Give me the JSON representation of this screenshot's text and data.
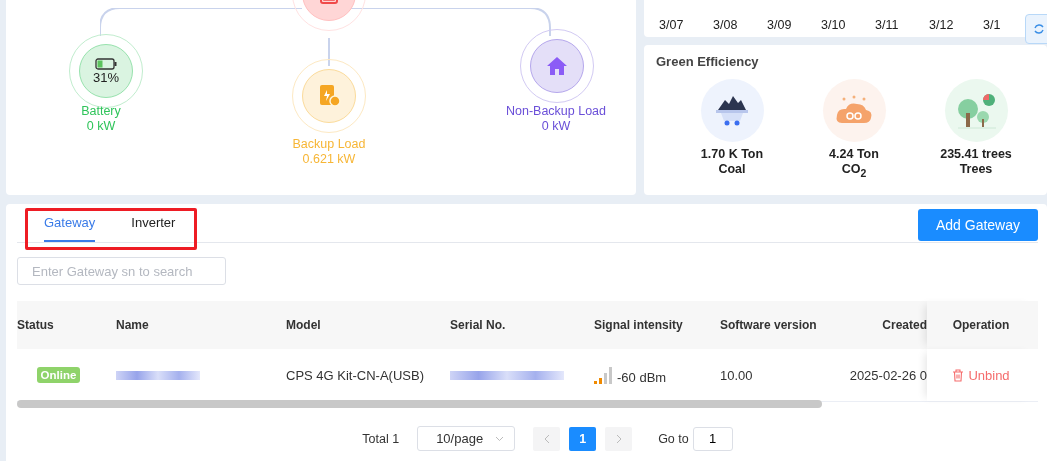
{
  "flow": {
    "nodes": [
      {
        "kind": "battery",
        "label": "Battery",
        "value": "0 kW",
        "reading": "31%"
      },
      {
        "kind": "backup",
        "label": "Backup Load",
        "value": "0.621 kW"
      },
      {
        "kind": "home",
        "label": "Non-Backup Load",
        "value": "0 kW"
      }
    ]
  },
  "forecast": {
    "dates": [
      "3/07",
      "3/08",
      "3/09",
      "3/10",
      "3/11",
      "3/12",
      "3/1"
    ]
  },
  "green_efficiency": {
    "title": "Green Efficiency",
    "items": [
      {
        "kind": "coal",
        "value": "1.70 K Ton",
        "label": "Coal"
      },
      {
        "kind": "co2",
        "value": "4.24 Ton",
        "label": "CO$_{2}$"
      },
      {
        "kind": "trees",
        "value": "235.41 trees",
        "label": "Trees"
      }
    ]
  },
  "tabs": [
    {
      "label": "Gateway",
      "selected": true
    },
    {
      "label": "Inverter",
      "selected": false
    }
  ],
  "add_button": "Add Gateway",
  "search": {
    "placeholder": "Enter Gateway sn to search"
  },
  "table": {
    "columns": [
      "Status",
      "Name",
      "Model",
      "Serial No.",
      "Signal intensity",
      "Software version",
      "Created",
      "Operation"
    ],
    "rows": [
      {
        "status": "Online",
        "model": "CPS 4G Kit-CN-A(USB)",
        "signal": "-60 dBm",
        "software_version": "10.00",
        "created": "2025-02-26 0",
        "action": "Unbind"
      }
    ]
  },
  "pagination": {
    "total": "Total 1",
    "page_size": "10/page",
    "pages": [
      {
        "label": "1",
        "selected": true
      }
    ],
    "goto_label": "Go to",
    "goto_value": "1"
  }
}
